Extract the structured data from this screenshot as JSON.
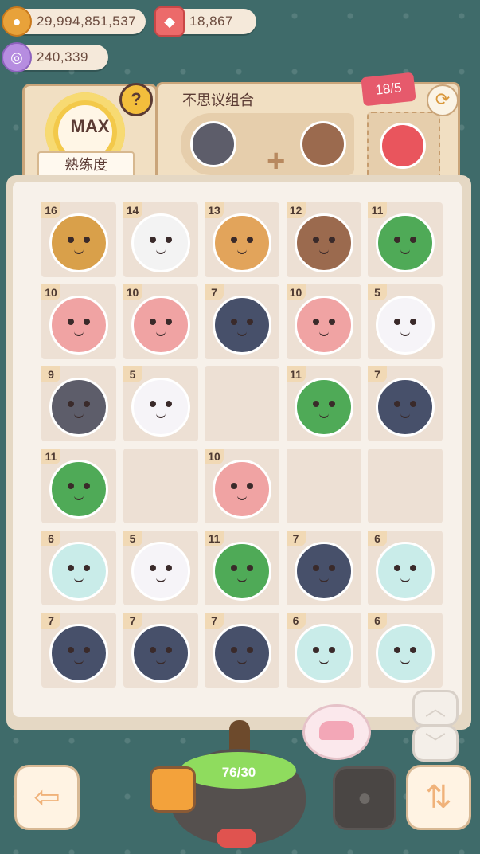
{
  "currencies": {
    "coins": "29,994,851,537",
    "gems": "18,867",
    "shells": "240,339"
  },
  "mastery": {
    "value": "MAX",
    "label": "熟练度",
    "help_icon": "?"
  },
  "combo": {
    "title": "不思议组合",
    "progress": "18/5",
    "plus": "+"
  },
  "cauldron": {
    "counter": "76/30"
  },
  "grid": [
    {
      "level": "16",
      "color": "#d9a04a"
    },
    {
      "level": "14",
      "color": "#f3f3f3"
    },
    {
      "level": "13",
      "color": "#e2a45b"
    },
    {
      "level": "12",
      "color": "#9b6a4e"
    },
    {
      "level": "11",
      "color": "#4faa57"
    },
    {
      "level": "10",
      "color": "#f0a3a3"
    },
    {
      "level": "10",
      "color": "#f0a3a3"
    },
    {
      "level": "7",
      "color": "#47506a"
    },
    {
      "level": "10",
      "color": "#f0a3a3"
    },
    {
      "level": "5",
      "color": "#f6f4f8"
    },
    {
      "level": "9",
      "color": "#5d5d6a"
    },
    {
      "level": "5",
      "color": "#f6f4f8"
    },
    {
      "level": "",
      "color": ""
    },
    {
      "level": "11",
      "color": "#4faa57"
    },
    {
      "level": "7",
      "color": "#47506a"
    },
    {
      "level": "11",
      "color": "#4faa57"
    },
    {
      "level": "",
      "color": ""
    },
    {
      "level": "10",
      "color": "#f0a3a3"
    },
    {
      "level": "",
      "color": ""
    },
    {
      "level": "",
      "color": ""
    },
    {
      "level": "6",
      "color": "#c9ece9"
    },
    {
      "level": "5",
      "color": "#f6f4f8"
    },
    {
      "level": "11",
      "color": "#4faa57"
    },
    {
      "level": "7",
      "color": "#47506a"
    },
    {
      "level": "6",
      "color": "#c9ece9"
    },
    {
      "level": "7",
      "color": "#47506a"
    },
    {
      "level": "7",
      "color": "#47506a"
    },
    {
      "level": "7",
      "color": "#47506a"
    },
    {
      "level": "6",
      "color": "#c9ece9"
    },
    {
      "level": "6",
      "color": "#c9ece9"
    }
  ],
  "buttons": {
    "back": "⇦",
    "sort": "⇅",
    "up": "︿",
    "down": "﹀",
    "refresh": "⟳"
  }
}
